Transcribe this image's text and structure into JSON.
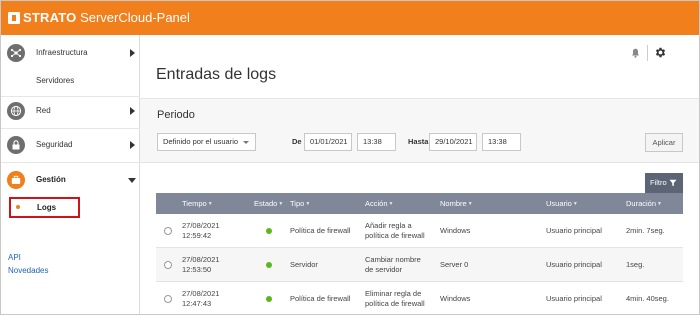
{
  "header": {
    "brand_bold": "STRATO",
    "brand_rest": " ServerCloud-Panel"
  },
  "sidebar": {
    "infraestructura": "Infraestructura",
    "servidores": "Servidores",
    "red": "Red",
    "seguridad": "Seguridad",
    "gestion": "Gestión",
    "logs": "Logs",
    "api": "API",
    "novedades": "Novedades"
  },
  "main": {
    "title": "Entradas de logs",
    "periodo": {
      "title": "Periodo",
      "select_value": "Definido por el usuario",
      "de_label": "De",
      "de_date": "01/01/2021",
      "de_time": "13:38",
      "hasta_label": "Hasta",
      "hasta_date": "29/10/2021",
      "hasta_time": "13:38",
      "apply_label": "Aplicar"
    },
    "filter_label": "Filtro",
    "table": {
      "columns": [
        "Tiempo",
        "Estado",
        "Tipo",
        "Acción",
        "Nombre",
        "Usuario",
        "Duración"
      ],
      "rows": [
        {
          "time": [
            "27/08/2021",
            "12:59:42"
          ],
          "status": "ok",
          "type": "Política de firewall",
          "action": [
            "Añadir regla a",
            "política de firewall"
          ],
          "name": "Windows",
          "user": "Usuario principal",
          "duration": "2min. 7seg."
        },
        {
          "time": [
            "27/08/2021",
            "12:53:50"
          ],
          "status": "ok",
          "type": "Servidor",
          "action": [
            "Cambiar nombre",
            "de servidor"
          ],
          "name": "Server 0",
          "user": "Usuario principal",
          "duration": "1seg."
        },
        {
          "time": [
            "27/08/2021",
            "12:47:43"
          ],
          "status": "ok",
          "type": "Política de firewall",
          "action": [
            "Eliminar regla de",
            "política de firewall"
          ],
          "name": "Windows",
          "user": "Usuario principal",
          "duration": "4min. 40seg."
        }
      ]
    }
  },
  "colors": {
    "brand": "#f07f1c",
    "status_ok": "#5cb61c",
    "table_header": "#7f8798",
    "highlight": "#d0121b"
  },
  "icons": [
    "network-icon",
    "globe-icon",
    "lock-icon",
    "briefcase-icon",
    "bell-icon",
    "gear-icon",
    "funnel-icon"
  ]
}
